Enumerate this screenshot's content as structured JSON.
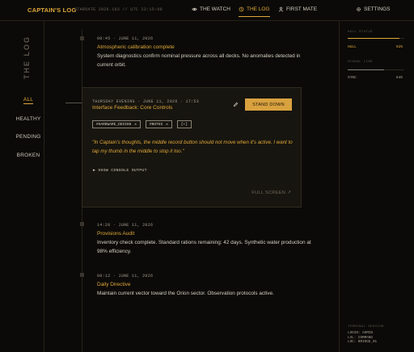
{
  "header": {
    "brand": "CAPTAIN'S LOG",
    "stardate": "STARDATE 2026.163 // UTC 23:15:09",
    "nav": [
      {
        "label": "THE WATCH",
        "icon": "eye-icon"
      },
      {
        "label": "THE LOG",
        "icon": "scroll-icon",
        "active": true
      },
      {
        "label": "FIRST MATE",
        "icon": "person-icon"
      }
    ],
    "settings": {
      "label": "SETTINGS",
      "icon": "gear-icon"
    }
  },
  "sidebar": {
    "title": "THE LOG",
    "filters": [
      {
        "label": "ALL",
        "active": true
      },
      {
        "label": "HEALTHY"
      },
      {
        "label": "PENDING"
      },
      {
        "label": "BROKEN"
      }
    ]
  },
  "entries": [
    {
      "date": "08:45 · JUNE 11, 2026",
      "title": "Atmospheric calibration complete",
      "body": "System diagnostics confirm nominal pressure across all decks. No anomalies detected in current orbit."
    },
    {
      "date": "14:20 · JUNE 11, 2026",
      "title": "Provisions Audit",
      "body": "Inventory check complete. Standard rations remaining: 42 days. Synthetic water production at 98% efficiency."
    },
    {
      "date": "08:12 · JUNE 11, 2026",
      "title": "Daily Directive",
      "body": "Maintain current vector toward the Orion sector. Observation protocols active."
    }
  ],
  "card": {
    "date": "THURSDAY EVENING · JUNE 11, 2026 · 17:53",
    "title": "Interface Feedback: Core Controls",
    "stand_down": "STAND DOWN",
    "tags": [
      "#HARDWARE_DESIGN",
      "#NOTES"
    ],
    "add_tag": "[+]",
    "quote": "\"In Captain's thoughts, the middle record button should not move when it's active. I want to tap my thumb in the middle to stop it too.\"",
    "console": "▶ SHOW CONSOLE OUTPUT",
    "fullscreen": "FULL SCREEN ↗"
  },
  "right_panel": {
    "section1_label": "HULL STATUS",
    "hull_label": "HULL",
    "hull_value": "92%",
    "hull_fraction": 0.92,
    "section2_label": "SIGNAL LINK",
    "sync_label": "SYNC",
    "sync_value": "64%",
    "sync_fraction": 0.64,
    "footer_label": "TERMINAL SESSION",
    "footer_lines": [
      "LOGIN: ADMIN",
      "LVL: COMMAND",
      "LOC: BRIDGE_01"
    ]
  },
  "colors": {
    "accent": "#e0a83a",
    "background": "#0b0a08",
    "card": "#17150f"
  }
}
